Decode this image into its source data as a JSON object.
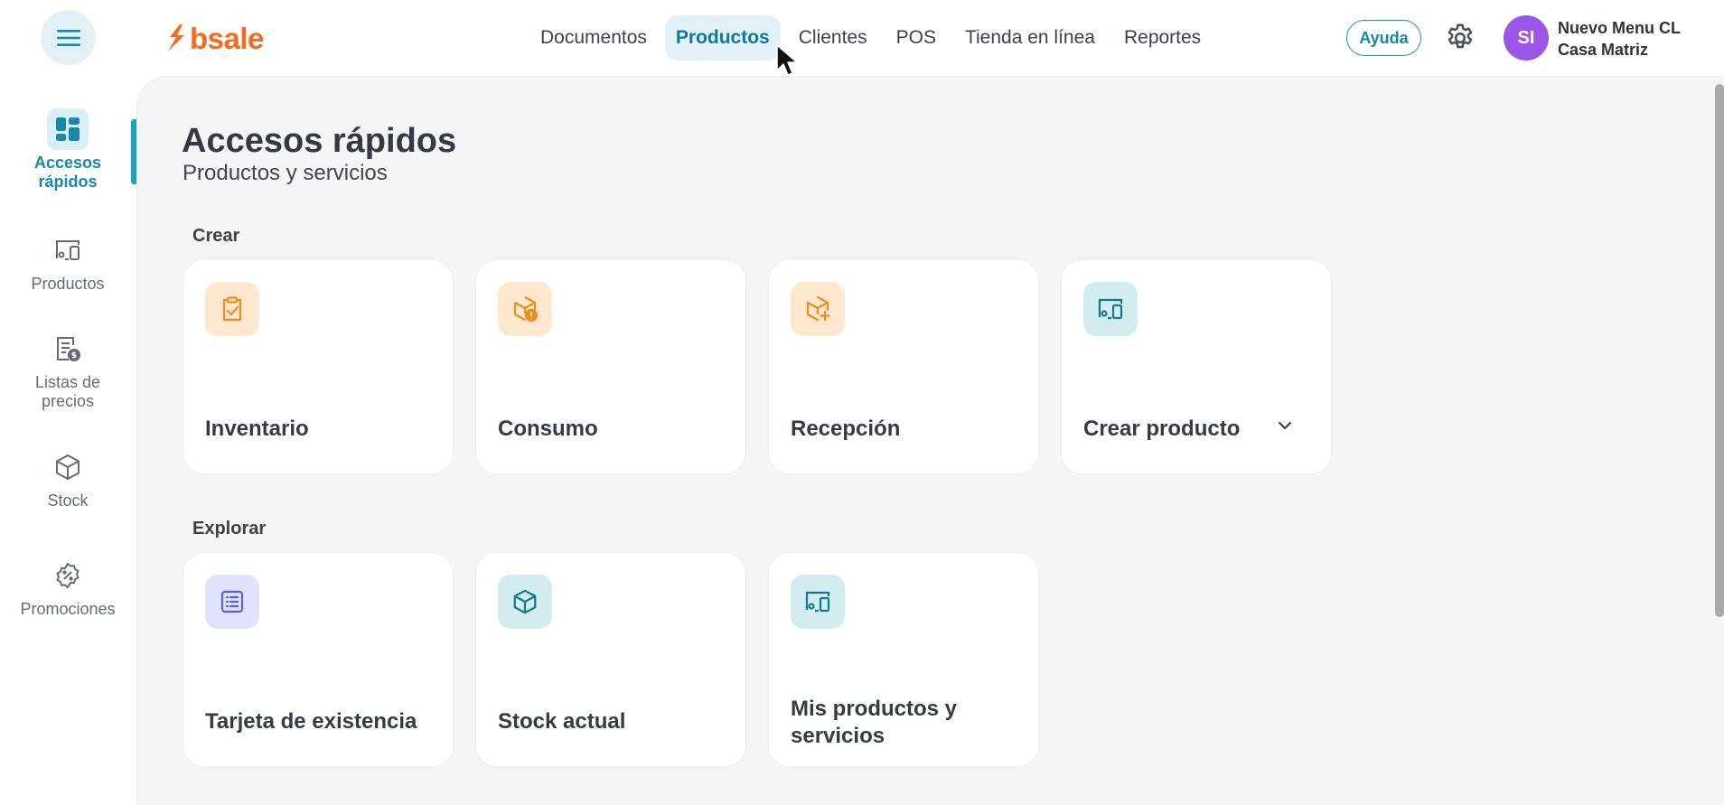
{
  "brand": {
    "name": "bsale",
    "color": "#f46a1f"
  },
  "topnav": {
    "items": [
      {
        "label": "Documentos",
        "active": false
      },
      {
        "label": "Productos",
        "active": true
      },
      {
        "label": "Clientes",
        "active": false
      },
      {
        "label": "POS",
        "active": false
      },
      {
        "label": "Tienda en línea",
        "active": false
      },
      {
        "label": "Reportes",
        "active": false
      }
    ]
  },
  "header": {
    "help_label": "Ayuda",
    "avatar_initials": "SI",
    "user_name": "Nuevo Menu CL",
    "user_branch": "Casa Matriz"
  },
  "sidebar": {
    "items": [
      {
        "label": "Accesos rápidos",
        "icon": "grid-icon",
        "active": true
      },
      {
        "label": "Productos",
        "icon": "product-devices-icon",
        "active": false
      },
      {
        "label": "Listas de precios",
        "icon": "price-list-icon",
        "active": false
      },
      {
        "label": "Stock",
        "icon": "box-icon",
        "active": false
      },
      {
        "label": "Promociones",
        "icon": "discount-badge-icon",
        "active": false
      }
    ]
  },
  "main": {
    "title": "Accesos rápidos",
    "subtitle": "Productos y servicios",
    "sections": [
      {
        "label": "Crear",
        "cards": [
          {
            "label": "Inventario",
            "icon": "clipboard-check-icon",
            "color": "orange"
          },
          {
            "label": "Consumo",
            "icon": "box-alert-icon",
            "color": "orange"
          },
          {
            "label": "Recepción",
            "icon": "box-plus-icon",
            "color": "orange"
          },
          {
            "label": "Crear producto",
            "icon": "product-devices-icon",
            "color": "teal",
            "has_dropdown": true
          }
        ]
      },
      {
        "label": "Explorar",
        "cards": [
          {
            "label": "Tarjeta de existencia",
            "icon": "list-card-icon",
            "color": "purple"
          },
          {
            "label": "Stock actual",
            "icon": "box-icon",
            "color": "teal"
          },
          {
            "label": "Mis productos y servicios",
            "icon": "product-devices-icon",
            "color": "teal"
          }
        ]
      }
    ]
  },
  "colors": {
    "accent": "#1788a8",
    "icon_orange": "#f08c1e",
    "icon_teal": "#137a8c",
    "icon_purple": "#5a5ed6",
    "avatar": "#9b56e8"
  }
}
